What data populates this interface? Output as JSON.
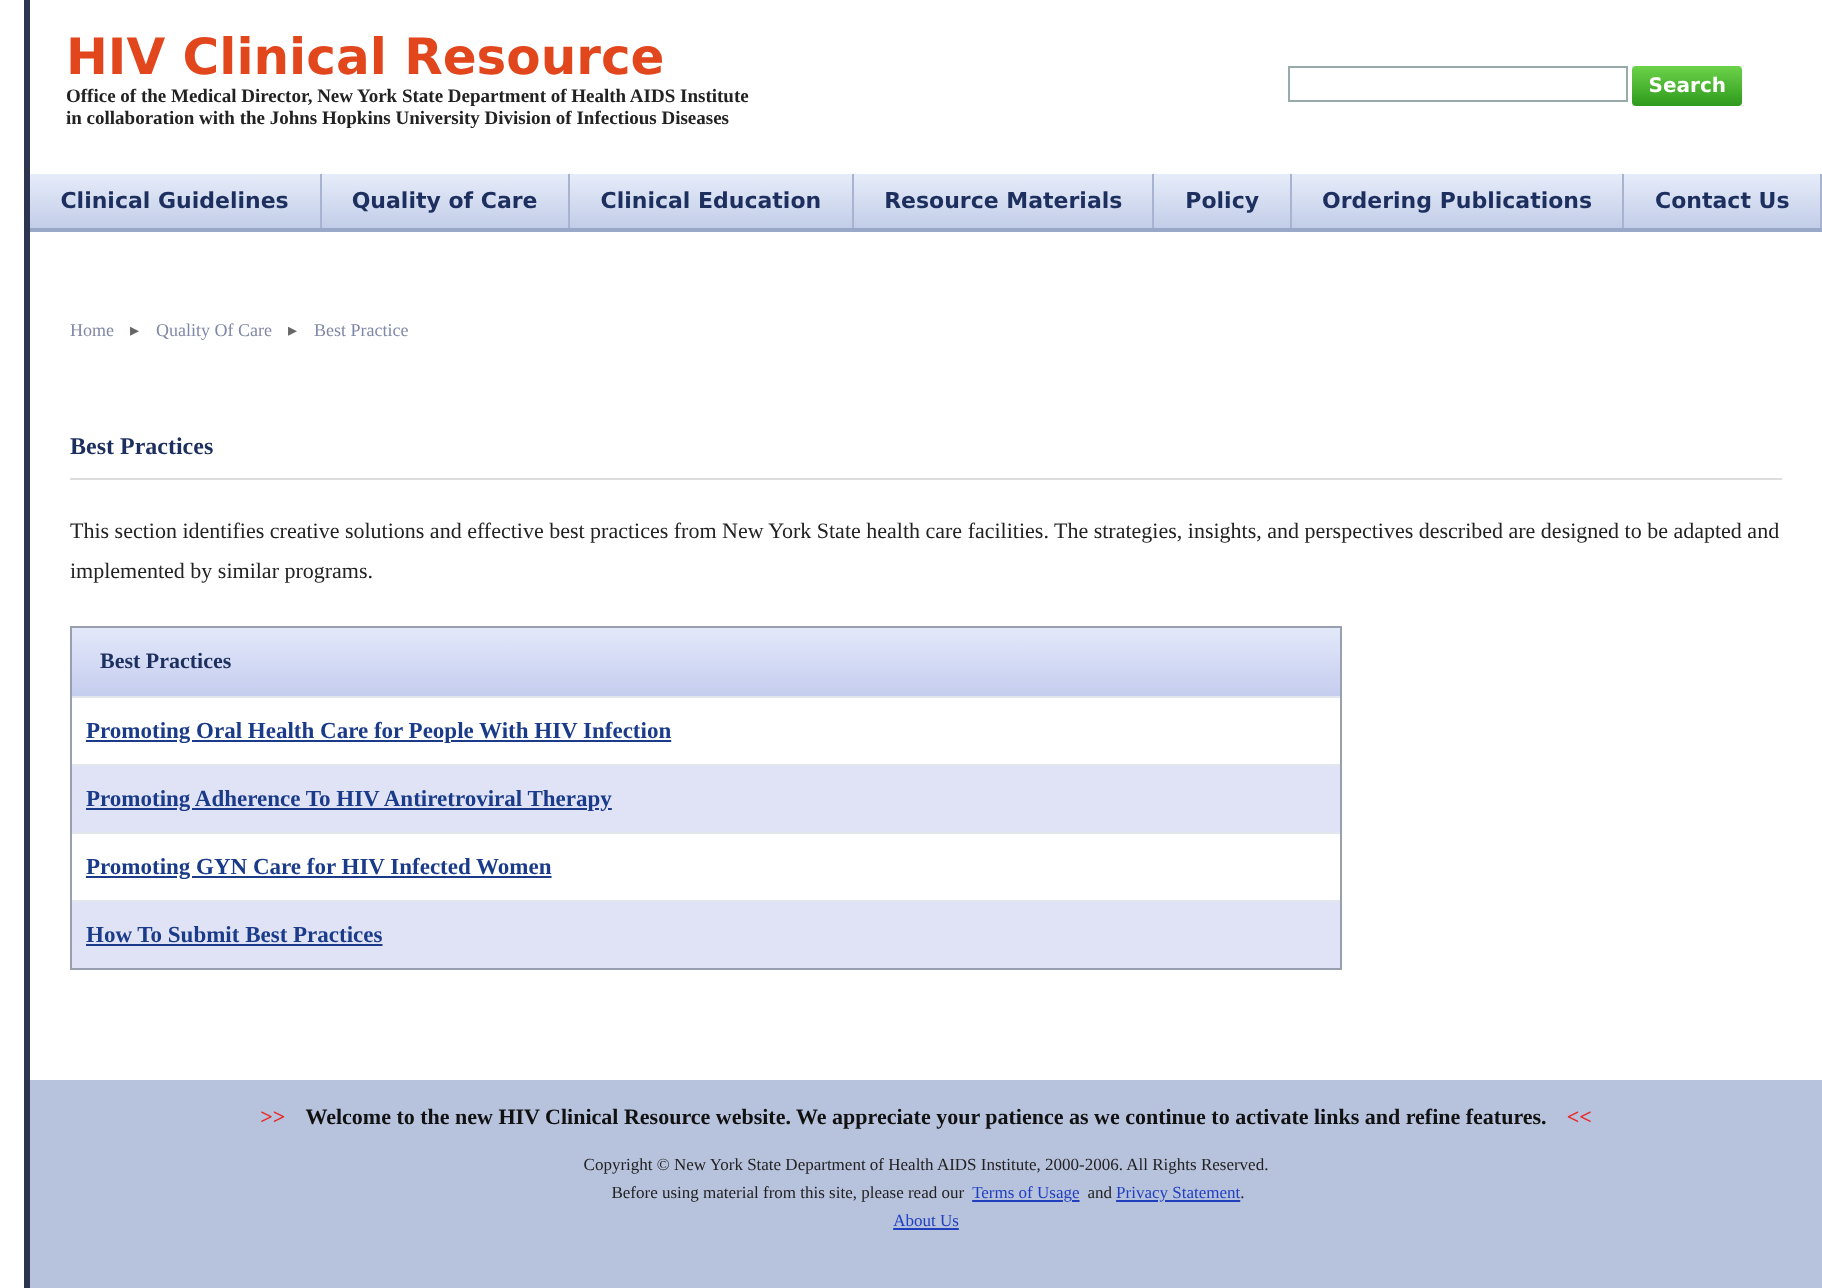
{
  "header": {
    "title": "HIV Clinical Resource",
    "subtitle_lines": [
      "Office of the Medical Director, New York State Department of Health AIDS Institute",
      "in collaboration with the Johns Hopkins University Division of Infectious Diseases"
    ]
  },
  "search": {
    "button": "Search"
  },
  "nav": [
    {
      "label": "Clinical Guidelines"
    },
    {
      "label": "Quality of Care"
    },
    {
      "label": "Clinical Education"
    },
    {
      "label": "Resource Materials"
    },
    {
      "label": "Policy"
    },
    {
      "label": "Ordering Publications"
    },
    {
      "label": "Contact Us"
    }
  ],
  "breadcrumb": [
    {
      "label": "Home"
    },
    {
      "label": "Quality Of Care"
    },
    {
      "label": "Best Practice"
    }
  ],
  "breadcrumb_separator": "▸",
  "page_title": "Best Practices",
  "intro": "This section identifies creative solutions and effective best practices from New York State health care facilities. The strategies, insights, and perspectives described are designed to be adapted and implemented by similar programs.",
  "table": {
    "heading": "Best Practices",
    "rows": [
      {
        "label": "Promoting Oral Health Care for People With HIV Infection"
      },
      {
        "label": "Promoting Adherence To HIV Antiretroviral Therapy"
      },
      {
        "label": "Promoting GYN Care for HIV Infected Women"
      },
      {
        "label": "How To Submit Best Practices"
      }
    ]
  },
  "footer": {
    "marker_left": ">>",
    "welcome": "Welcome to the new HIV Clinical Resource website. We appreciate your patience as we continue to activate links and refine features.",
    "marker_right": "<<",
    "copyright": "Copyright © New York State Department of Health AIDS Institute, 2000-2006. All Rights Reserved.",
    "notice_before": "Before using material from this site, please read our",
    "terms_link": "Terms of Usage",
    "notice_and": "and",
    "privacy_link": "Privacy Statement",
    "notice_end": ".",
    "about_link": "About Us"
  }
}
